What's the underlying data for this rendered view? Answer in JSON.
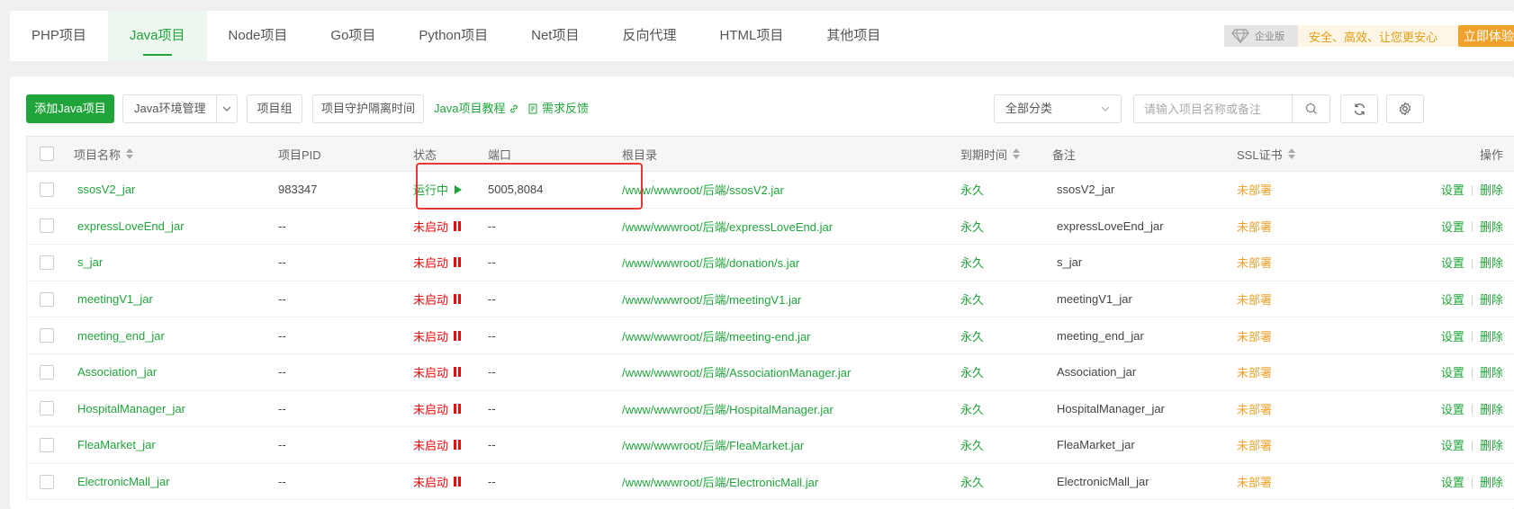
{
  "tabs": [
    "PHP项目",
    "Java项目",
    "Node项目",
    "Go项目",
    "Python项目",
    "Net项目",
    "反向代理",
    "HTML项目",
    "其他项目"
  ],
  "active_tab": "Java项目",
  "enterprise": {
    "badge": "企业版",
    "slogan": "安全、高效、让您更安心",
    "try_label": "立即体验"
  },
  "toolbar": {
    "add_label": "添加Java项目",
    "env_label": "Java环境管理",
    "group_label": "项目组",
    "guard_label": "项目守护隔离时间",
    "tutorial_label": "Java项目教程",
    "feedback_label": "需求反馈",
    "category_value": "全部分类",
    "search_placeholder": "请输入项目名称或备注"
  },
  "columns": {
    "name": "项目名称",
    "pid": "项目PID",
    "status": "状态",
    "port": "端口",
    "root": "根目录",
    "expire": "到期时间",
    "remark": "备注",
    "ssl": "SSL证书",
    "ops": "操作"
  },
  "rows": [
    {
      "name": "ssosV2_jar",
      "pid": "983347",
      "status": "运行中",
      "running": true,
      "port": "5005,8084",
      "root": "/www/wwwroot/后端/ssosV2.jar",
      "expire": "永久",
      "remark": "ssosV2_jar",
      "ssl": "未部署",
      "op_set": "设置",
      "op_del": "删除"
    },
    {
      "name": "expressLoveEnd_jar",
      "pid": "--",
      "status": "未启动",
      "running": false,
      "port": "--",
      "root": "/www/wwwroot/后端/expressLoveEnd.jar",
      "expire": "永久",
      "remark": "expressLoveEnd_jar",
      "ssl": "未部署",
      "op_set": "设置",
      "op_del": "删除"
    },
    {
      "name": "s_jar",
      "pid": "--",
      "status": "未启动",
      "running": false,
      "port": "--",
      "root": "/www/wwwroot/后端/donation/s.jar",
      "expire": "永久",
      "remark": "s_jar",
      "ssl": "未部署",
      "op_set": "设置",
      "op_del": "删除"
    },
    {
      "name": "meetingV1_jar",
      "pid": "--",
      "status": "未启动",
      "running": false,
      "port": "--",
      "root": "/www/wwwroot/后端/meetingV1.jar",
      "expire": "永久",
      "remark": "meetingV1_jar",
      "ssl": "未部署",
      "op_set": "设置",
      "op_del": "删除"
    },
    {
      "name": "meeting_end_jar",
      "pid": "--",
      "status": "未启动",
      "running": false,
      "port": "--",
      "root": "/www/wwwroot/后端/meeting-end.jar",
      "expire": "永久",
      "remark": "meeting_end_jar",
      "ssl": "未部署",
      "op_set": "设置",
      "op_del": "删除"
    },
    {
      "name": "Association_jar",
      "pid": "--",
      "status": "未启动",
      "running": false,
      "port": "--",
      "root": "/www/wwwroot/后端/AssociationManager.jar",
      "expire": "永久",
      "remark": "Association_jar",
      "ssl": "未部署",
      "op_set": "设置",
      "op_del": "删除"
    },
    {
      "name": "HospitalManager_jar",
      "pid": "--",
      "status": "未启动",
      "running": false,
      "port": "--",
      "root": "/www/wwwroot/后端/HospitalManager.jar",
      "expire": "永久",
      "remark": "HospitalManager_jar",
      "ssl": "未部署",
      "op_set": "设置",
      "op_del": "删除"
    },
    {
      "name": "FleaMarket_jar",
      "pid": "--",
      "status": "未启动",
      "running": false,
      "port": "--",
      "root": "/www/wwwroot/后端/FleaMarket.jar",
      "expire": "永久",
      "remark": "FleaMarket_jar",
      "ssl": "未部署",
      "op_set": "设置",
      "op_del": "删除"
    },
    {
      "name": "ElectronicMall_jar",
      "pid": "--",
      "status": "未启动",
      "running": false,
      "port": "--",
      "root": "/www/wwwroot/后端/ElectronicMall.jar",
      "expire": "永久",
      "remark": "ElectronicMall_jar",
      "ssl": "未部署",
      "op_set": "设置",
      "op_del": "删除"
    }
  ],
  "colors": {
    "accent": "#20a53a",
    "stopped": "#ef0808",
    "ssl": "#f1a22c",
    "highlight": "#e53935"
  }
}
